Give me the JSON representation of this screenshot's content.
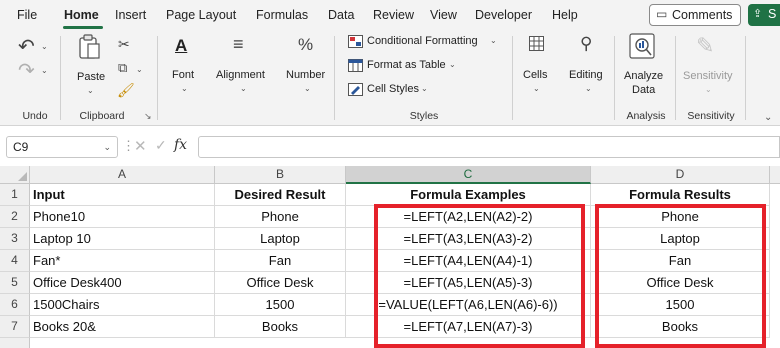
{
  "menu": {
    "tabs": [
      "File",
      "Home",
      "Insert",
      "Page Layout",
      "Formulas",
      "Data",
      "Review",
      "View",
      "Developer",
      "Help"
    ],
    "active_tab": "Home",
    "comments_label": "Comments",
    "share_label": "S"
  },
  "ribbon": {
    "undo_group": "Undo",
    "clipboard_group": "Clipboard",
    "paste_label": "Paste",
    "font_label": "Font",
    "alignment_label": "Alignment",
    "number_label": "Number",
    "conditional_formatting": "Conditional Formatting",
    "format_as_table": "Format as Table",
    "cell_styles": "Cell Styles",
    "styles_group": "Styles",
    "cells_label": "Cells",
    "editing_label": "Editing",
    "analyze_data_line1": "Analyze",
    "analyze_data_line2": "Data",
    "analysis_group": "Analysis",
    "sensitivity_label": "Sensitivity",
    "sensitivity_group": "Sensitivity"
  },
  "formula_bar": {
    "name_box": "C9",
    "fx": "fx",
    "formula": ""
  },
  "sheet": {
    "columns": [
      "A",
      "B",
      "C",
      "D"
    ],
    "selected_column": "C",
    "row_numbers": [
      "1",
      "2",
      "3",
      "4",
      "5",
      "6",
      "7"
    ],
    "headers": {
      "a": "Input",
      "b": "Desired Result",
      "c": "Formula Examples",
      "d": "Formula Results"
    },
    "rows": [
      {
        "a": "Phone10",
        "b": "Phone",
        "c": "=LEFT(A2,LEN(A2)-2)",
        "d": "Phone"
      },
      {
        "a": "Laptop 10",
        "b": "Laptop",
        "c": "=LEFT(A3,LEN(A3)-2)",
        "d": "Laptop"
      },
      {
        "a": "Fan*",
        "b": "Fan",
        "c": "=LEFT(A4,LEN(A4)-1)",
        "d": "Fan"
      },
      {
        "a": "Office Desk400",
        "b": "Office Desk",
        "c": "=LEFT(A5,LEN(A5)-3)",
        "d": "Office Desk"
      },
      {
        "a": "1500Chairs",
        "b": "1500",
        "c": "=VALUE(LEFT(A6,LEN(A6)-6))",
        "d": "1500"
      },
      {
        "a": "Books 20&",
        "b": "Books",
        "c": "=LEFT(A7,LEN(A7)-3)",
        "d": "Books"
      }
    ]
  },
  "colors": {
    "accent_green": "#217346",
    "highlight_red": "#e5212a"
  }
}
